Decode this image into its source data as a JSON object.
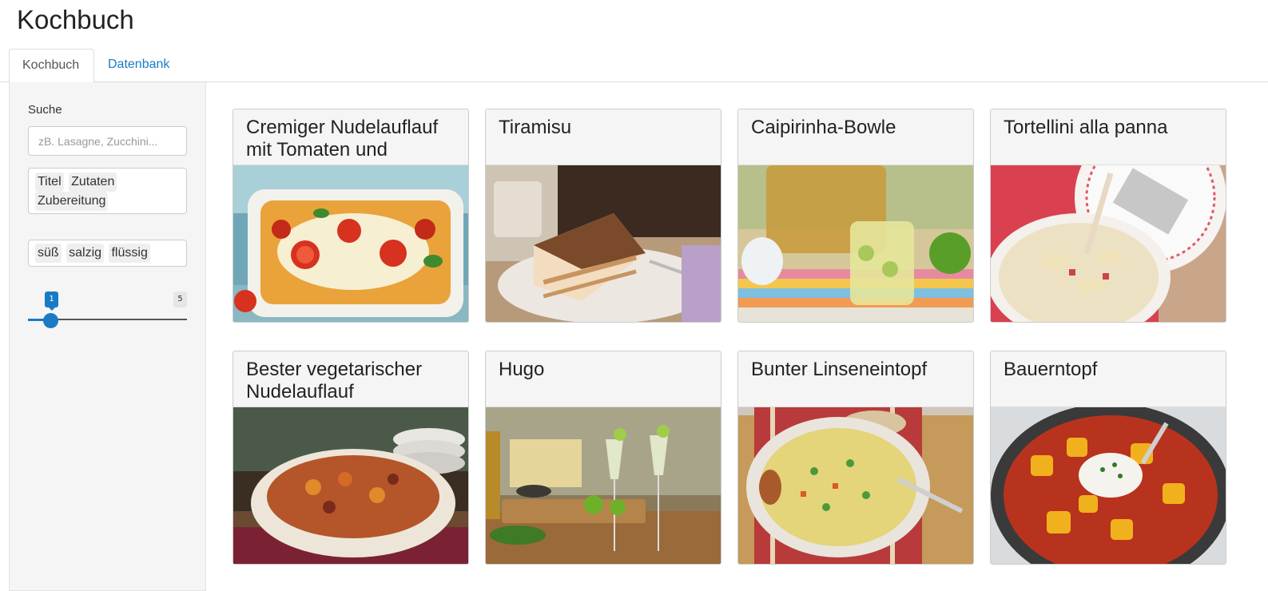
{
  "app": {
    "title": "Kochbuch"
  },
  "tabs": [
    {
      "label": "Kochbuch",
      "active": true
    },
    {
      "label": "Datenbank",
      "active": false
    }
  ],
  "sidebar": {
    "search_label": "Suche",
    "search_placeholder": "zB. Lasagne, Zucchini...",
    "search_fields": [
      "Titel",
      "Zutaten",
      "Zubereitung"
    ],
    "types": [
      "süß",
      "salzig",
      "flüssig"
    ],
    "slider": {
      "value": "1",
      "max": "5"
    }
  },
  "recipes": [
    {
      "title": "Cremiger Nudelauflauf mit Tomaten und",
      "image": "pasta-bake-image"
    },
    {
      "title": "Tiramisu",
      "image": "tiramisu-image"
    },
    {
      "title": "Caipirinha-Bowle",
      "image": "caipirinha-bowle-image"
    },
    {
      "title": "Tortellini alla panna",
      "image": "tortellini-image"
    },
    {
      "title": "Bester vegetarischer Nudelauflauf",
      "image": "vegetarian-pasta-bake-image"
    },
    {
      "title": "Hugo",
      "image": "hugo-cocktail-image"
    },
    {
      "title": "Bunter Linseneintopf",
      "image": "lentil-stew-image"
    },
    {
      "title": "Bauerntopf",
      "image": "bauerntopf-image"
    }
  ],
  "colors": {
    "accent": "#1a7bc4",
    "sidebar_bg": "#f5f5f5",
    "card_head_bg": "#f5f5f5"
  }
}
